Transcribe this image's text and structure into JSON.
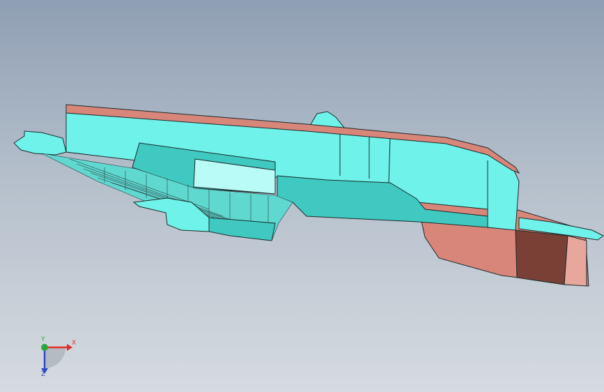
{
  "viewport": {
    "background_top": "#8f9fb3",
    "background_bottom": "#d6dbe1"
  },
  "model": {
    "part_colors": {
      "cyan_face": "#6ff2ea",
      "cyan_light": "#b8fbf7",
      "cyan_shadow": "#3fc9c0",
      "salmon_face": "#d9867a",
      "salmon_dark": "#7a3f35",
      "edge": "#1a2a2a",
      "mesh": "#2b3b3d"
    }
  },
  "triad": {
    "x_label": "X",
    "y_label": "Y",
    "z_label": "Z",
    "x_color": "#e0302a",
    "y_color": "#2aa83a",
    "z_color": "#3048c8"
  }
}
